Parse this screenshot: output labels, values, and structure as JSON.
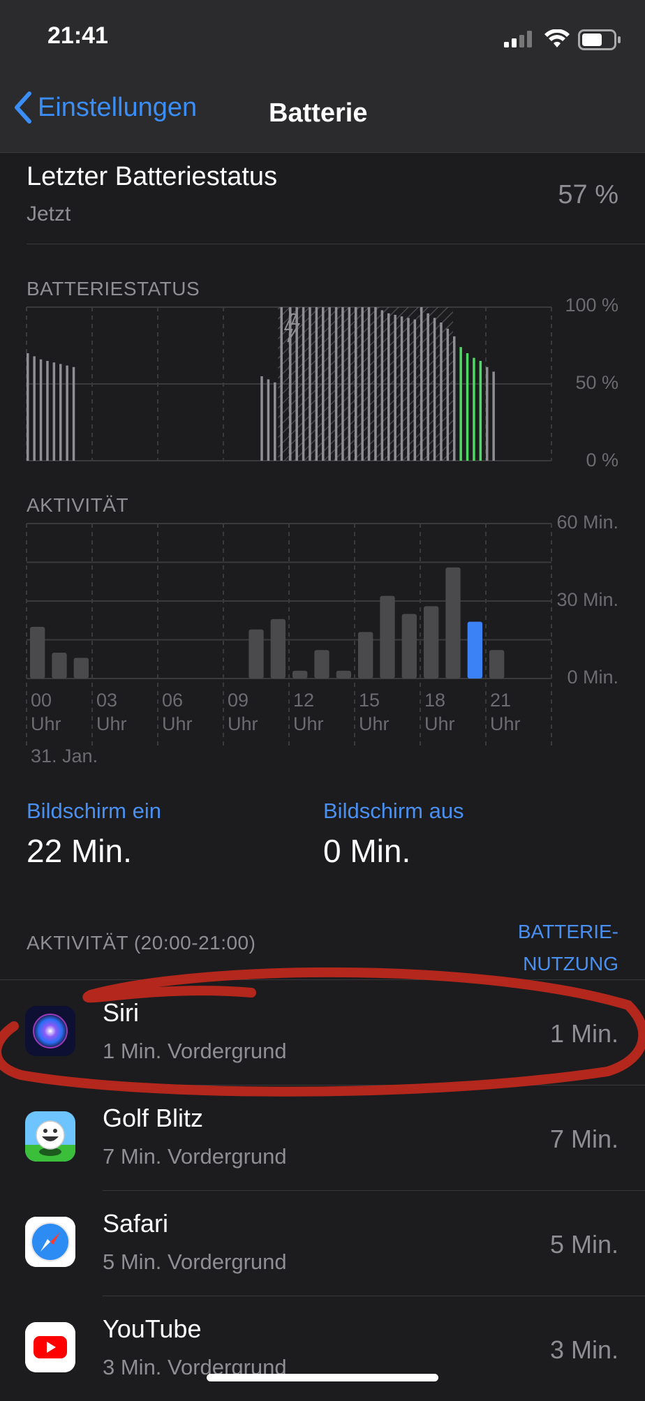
{
  "status_bar": {
    "time": "21:41"
  },
  "nav": {
    "back_label": "Einstellungen",
    "title": "Batterie"
  },
  "last_status": {
    "title": "Letzter Batteriestatus",
    "subtitle": "Jetzt",
    "value": "57 %"
  },
  "battery_chart": {
    "label": "BATTERIESTATUS",
    "y_ticks": [
      "100 %",
      "50 %",
      "0 %"
    ]
  },
  "activity_chart": {
    "label": "AKTIVITÄT",
    "y_ticks": [
      "60 Min.",
      "30 Min.",
      "0 Min."
    ],
    "x_hours": [
      "00",
      "03",
      "06",
      "09",
      "12",
      "15",
      "18",
      "21"
    ],
    "x_unit": "Uhr",
    "date_label": "31. Jan."
  },
  "screen": {
    "on_label": "Bildschirm ein",
    "on_value": "22 Min.",
    "off_label": "Bildschirm aus",
    "off_value": "0 Min."
  },
  "activity_list": {
    "label": "AKTIVITÄT (20:00-21:00)",
    "toggle_line1": "BATTERIE-",
    "toggle_line2": "NUTZUNG",
    "apps": [
      {
        "name": "Siri",
        "detail": "1 Min. Vordergrund",
        "time": "1 Min.",
        "icon": "siri-icon"
      },
      {
        "name": "Golf Blitz",
        "detail": "7 Min. Vordergrund",
        "time": "7 Min.",
        "icon": "golf-blitz-icon"
      },
      {
        "name": "Safari",
        "detail": "5 Min. Vordergrund",
        "time": "5 Min.",
        "icon": "safari-icon"
      },
      {
        "name": "YouTube",
        "detail": "3 Min. Vordergrund",
        "time": "3 Min.",
        "icon": "youtube-icon"
      }
    ]
  },
  "chart_data": [
    {
      "type": "bar",
      "title": "BATTERIESTATUS",
      "ylabel": "",
      "ylim": [
        0,
        100
      ],
      "y_unit": "%",
      "x_range_hours": [
        0,
        24
      ],
      "colors": {
        "normal": "#8e8e93",
        "current": "#4cd964",
        "charging_hatch": "#6e6e73"
      },
      "charging_interval_hours": [
        11.5,
        19.5
      ],
      "series": [
        {
          "values": [
            {
              "h": 0.0,
              "v": 70
            },
            {
              "h": 0.3,
              "v": 68
            },
            {
              "h": 0.6,
              "v": 66
            },
            {
              "h": 0.9,
              "v": 65
            },
            {
              "h": 1.2,
              "v": 64
            },
            {
              "h": 1.5,
              "v": 63
            },
            {
              "h": 1.8,
              "v": 62
            },
            {
              "h": 2.1,
              "v": 61
            },
            {
              "h": 10.7,
              "v": 55
            },
            {
              "h": 11.0,
              "v": 53
            },
            {
              "h": 11.3,
              "v": 51
            },
            {
              "h": 11.6,
              "v": 100
            },
            {
              "h": 12.0,
              "v": 100
            },
            {
              "h": 12.3,
              "v": 100
            },
            {
              "h": 12.6,
              "v": 100
            },
            {
              "h": 12.9,
              "v": 100
            },
            {
              "h": 13.2,
              "v": 100
            },
            {
              "h": 13.5,
              "v": 100
            },
            {
              "h": 13.8,
              "v": 100
            },
            {
              "h": 14.1,
              "v": 100
            },
            {
              "h": 14.4,
              "v": 100
            },
            {
              "h": 14.7,
              "v": 100
            },
            {
              "h": 15.0,
              "v": 100
            },
            {
              "h": 15.3,
              "v": 100
            },
            {
              "h": 15.6,
              "v": 100
            },
            {
              "h": 15.9,
              "v": 100
            },
            {
              "h": 16.2,
              "v": 98
            },
            {
              "h": 16.5,
              "v": 96
            },
            {
              "h": 16.8,
              "v": 95
            },
            {
              "h": 17.1,
              "v": 94
            },
            {
              "h": 17.4,
              "v": 93
            },
            {
              "h": 17.7,
              "v": 92
            },
            {
              "h": 18.0,
              "v": 100
            },
            {
              "h": 18.3,
              "v": 96
            },
            {
              "h": 18.6,
              "v": 93
            },
            {
              "h": 18.9,
              "v": 90
            },
            {
              "h": 19.2,
              "v": 86
            },
            {
              "h": 19.5,
              "v": 81
            },
            {
              "h": 19.8,
              "v": 74,
              "current": true
            },
            {
              "h": 20.1,
              "v": 70,
              "current": true
            },
            {
              "h": 20.4,
              "v": 67,
              "current": true
            },
            {
              "h": 20.7,
              "v": 65,
              "current": true
            },
            {
              "h": 21.0,
              "v": 61
            },
            {
              "h": 21.3,
              "v": 58
            }
          ]
        }
      ]
    },
    {
      "type": "bar",
      "title": "AKTIVITÄT",
      "ylim": [
        0,
        60
      ],
      "y_unit": "Min.",
      "categories": [
        "00",
        "01",
        "02",
        "03",
        "04",
        "05",
        "06",
        "07",
        "08",
        "09",
        "10",
        "11",
        "12",
        "13",
        "14",
        "15",
        "16",
        "17",
        "18",
        "19",
        "20",
        "21",
        "22",
        "23"
      ],
      "values": [
        20,
        10,
        8,
        0,
        0,
        0,
        0,
        0,
        0,
        0,
        19,
        23,
        3,
        11,
        3,
        18,
        32,
        25,
        28,
        43,
        22,
        11,
        0,
        0
      ],
      "highlight_index": 20,
      "colors": {
        "normal": "#4a4a4d",
        "current": "#3b82f6"
      }
    }
  ]
}
